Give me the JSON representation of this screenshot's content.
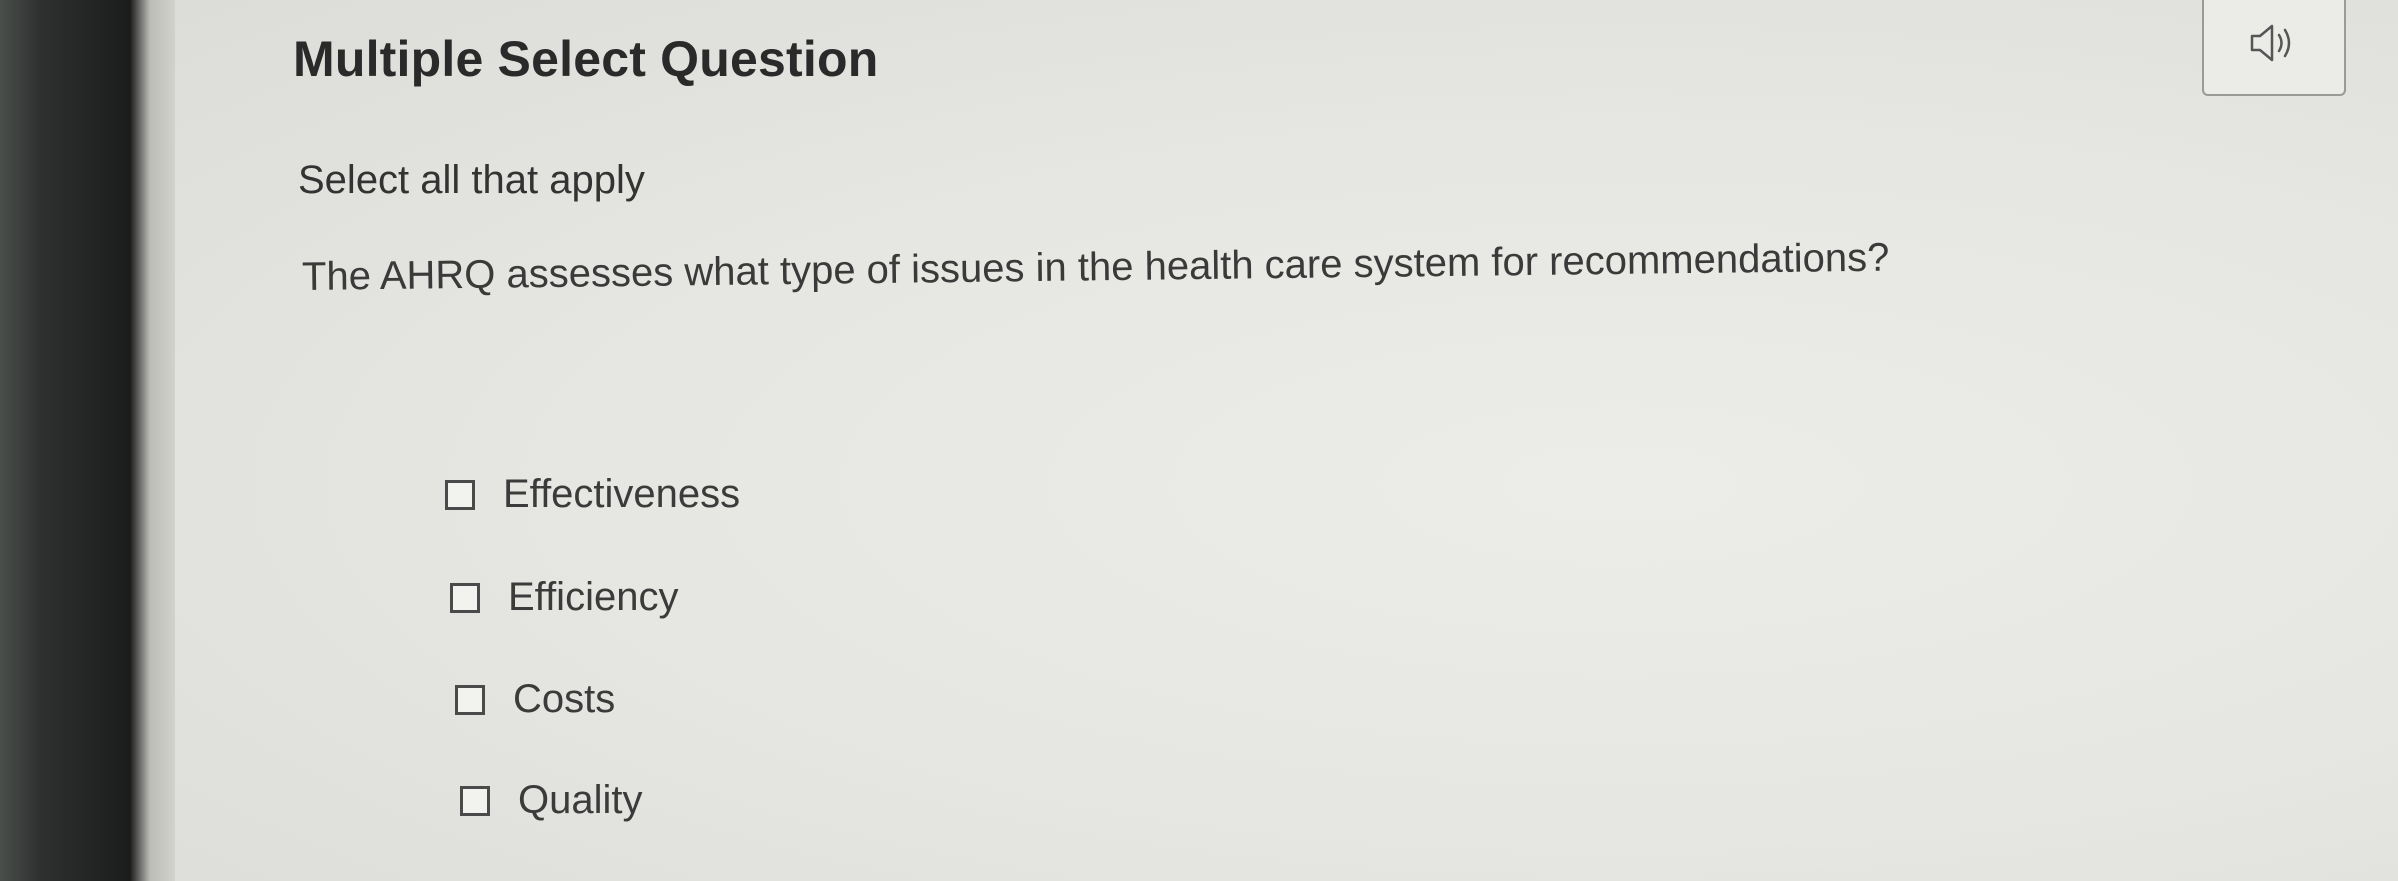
{
  "question": {
    "type_title": "Multiple Select Question",
    "instruction": "Select all that apply",
    "prompt": "The AHRQ assesses what type of issues in the health care system for recommendations?"
  },
  "options": [
    {
      "label": "Effectiveness",
      "checked": false
    },
    {
      "label": "Efficiency",
      "checked": false
    },
    {
      "label": "Costs",
      "checked": false
    },
    {
      "label": "Quality",
      "checked": false
    }
  ],
  "toolbar": {
    "audio_icon": "speaker-icon"
  }
}
